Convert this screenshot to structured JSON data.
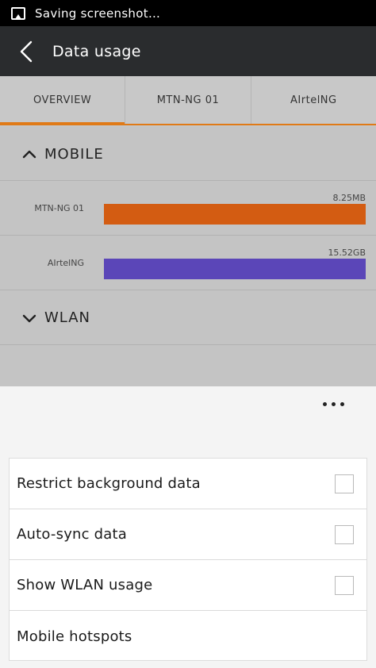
{
  "status_bar": {
    "text": "Saving screenshot…",
    "icon": "image-icon"
  },
  "app_bar": {
    "title": "Data usage",
    "back_icon": "back-arrow-icon"
  },
  "tabs": [
    {
      "label": "OVERVIEW",
      "active": true
    },
    {
      "label": "MTN-NG 01",
      "active": false
    },
    {
      "label": "AIrtelNG",
      "active": false
    }
  ],
  "mobile_section": {
    "title": "MOBILE",
    "expanded": true,
    "icon": "chevron-up-icon"
  },
  "usage": [
    {
      "label": "MTN-NG 01",
      "value": "8.25MB",
      "color": "#d35c12"
    },
    {
      "label": "AIrtelNG",
      "value": "15.52GB",
      "color": "#5b46b8"
    }
  ],
  "wlan_section": {
    "title": "WLAN",
    "expanded": false,
    "icon": "chevron-down-icon"
  },
  "menu": {
    "more_icon": "more-dots-icon",
    "items": [
      {
        "label": "Restrict background data",
        "checkbox": true,
        "checked": false
      },
      {
        "label": "Auto-sync data",
        "checkbox": true,
        "checked": false
      },
      {
        "label": "Show WLAN usage",
        "checkbox": true,
        "checked": false
      },
      {
        "label": "Mobile hotspots",
        "checkbox": false
      }
    ]
  },
  "colors": {
    "accent": "#e07a17",
    "app_bar": "#2a2c2e",
    "status_bar": "#000000"
  }
}
